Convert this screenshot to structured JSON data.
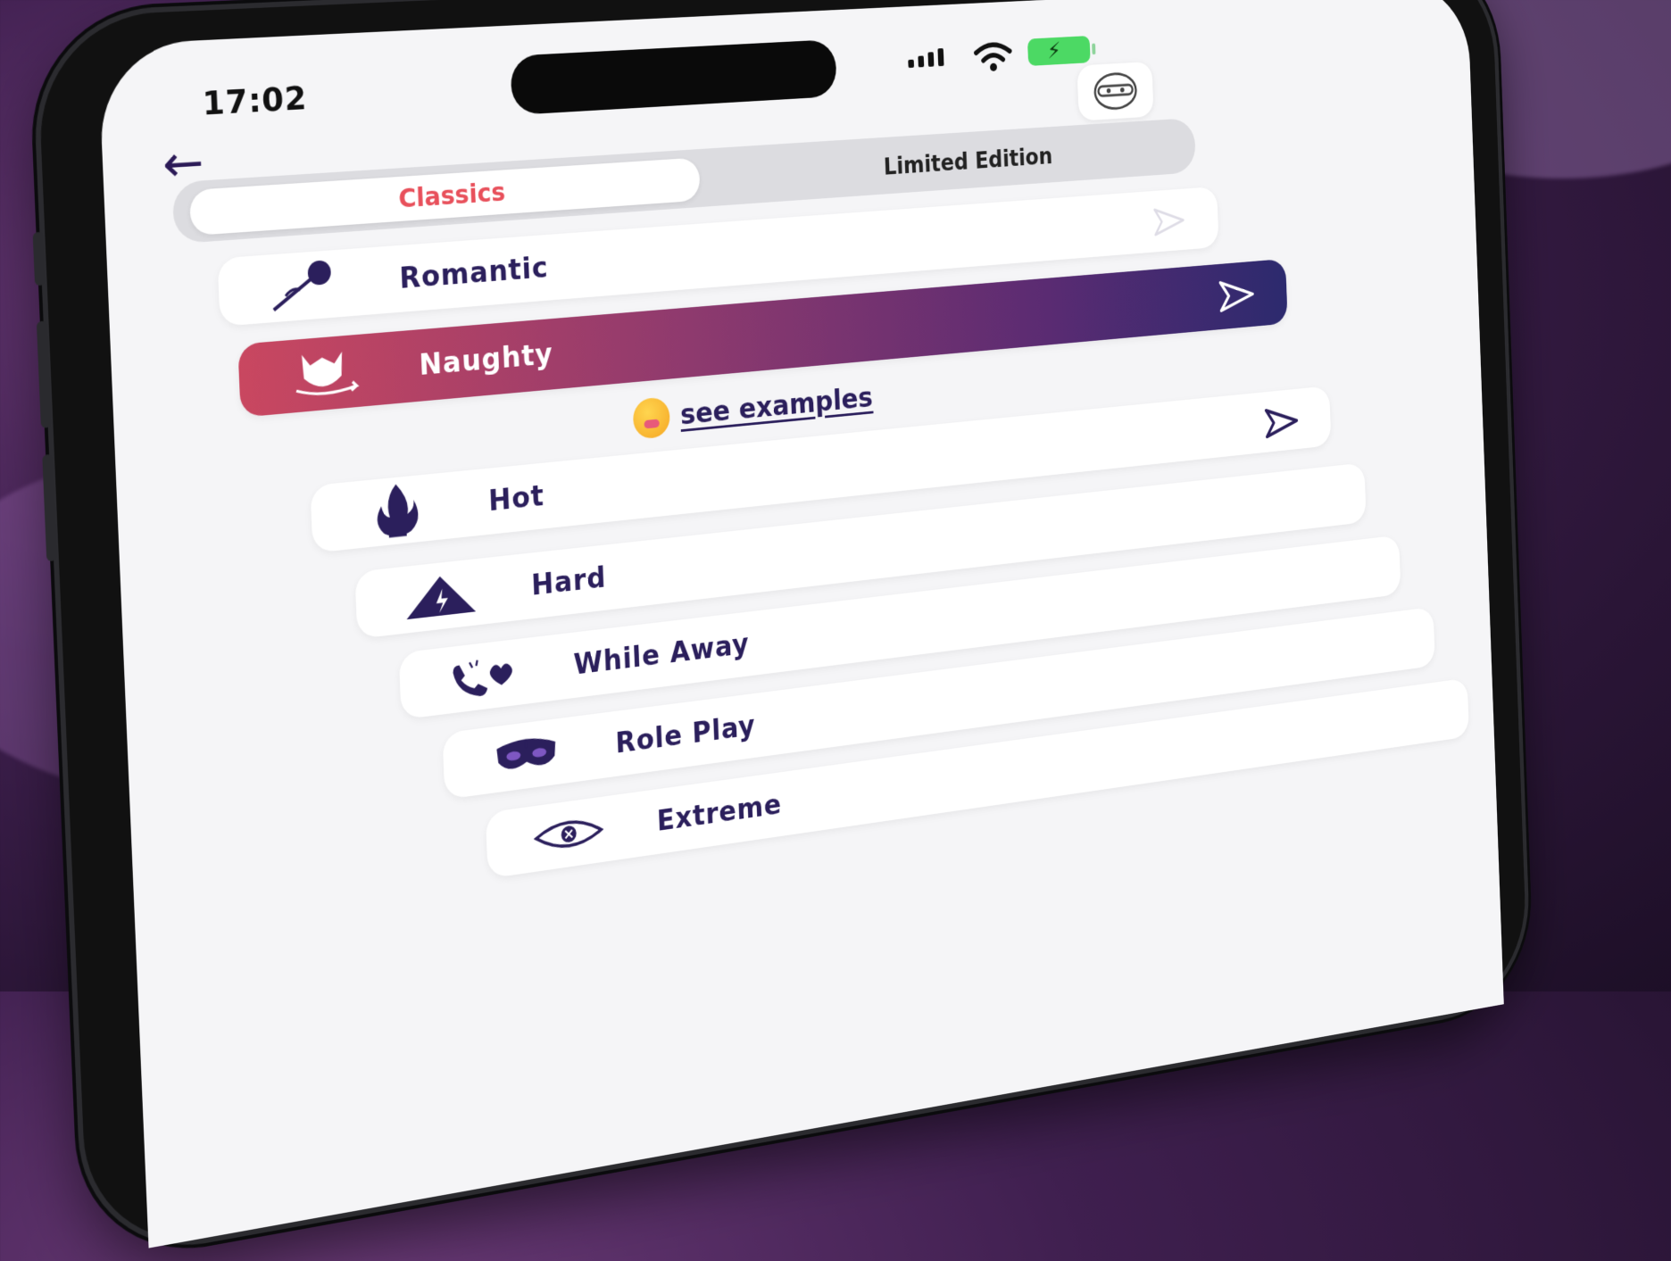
{
  "status_bar": {
    "time": "17:02"
  },
  "tabs": [
    {
      "label": "Classics",
      "active": true
    },
    {
      "label": "Limited Edition",
      "active": false
    }
  ],
  "categories": [
    {
      "label": "Romantic",
      "icon": "rose-icon"
    },
    {
      "label": "Naughty",
      "icon": "devil-icon",
      "selected": true
    },
    {
      "label": "Hot",
      "icon": "flame-icon"
    },
    {
      "label": "Hard",
      "icon": "warning-bolt-icon"
    },
    {
      "label": "While Away",
      "icon": "phone-heart-icon"
    },
    {
      "label": "Role Play",
      "icon": "mask-icon"
    },
    {
      "label": "Extreme",
      "icon": "eye-x-icon"
    }
  ],
  "examples_link": "see examples",
  "colors": {
    "accent": "#e8505b",
    "text": "#2b1f5c",
    "selected_start": "#c94760",
    "selected_end": "#2c2a6e"
  }
}
